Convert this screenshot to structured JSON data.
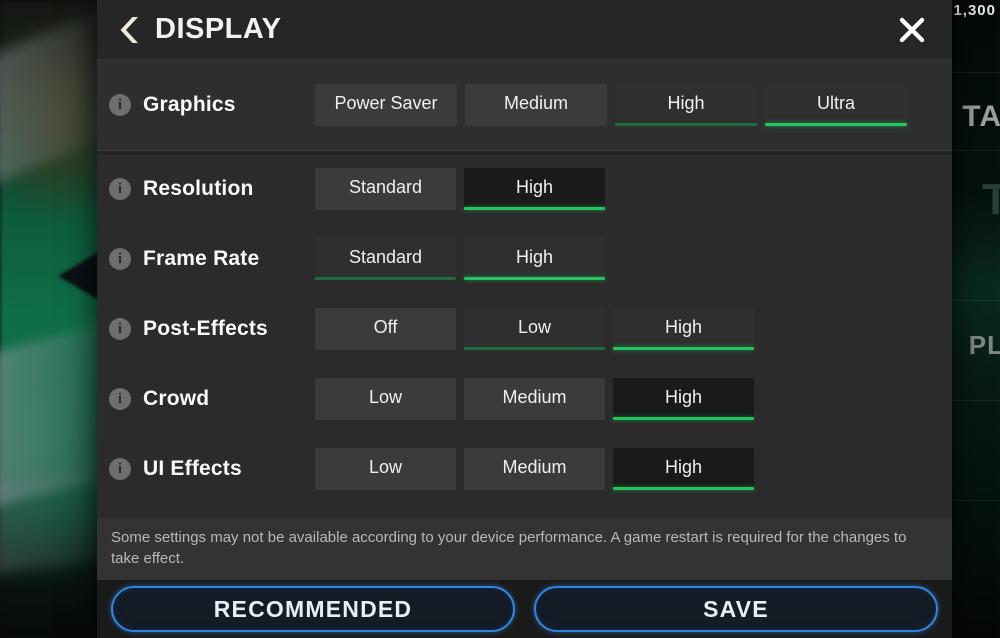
{
  "background": {
    "hud_score": "1,300",
    "hud_text_1": "TA",
    "hud_text_2": "T",
    "hud_text_3": "PL"
  },
  "header": {
    "title": "DISPLAY",
    "back_icon": "chevron-left-icon",
    "close_icon": "close-icon"
  },
  "settings": [
    {
      "label": "Graphics",
      "info_icon": "info-icon",
      "options": [
        {
          "label": "Power Saver",
          "state": "plain",
          "bar": "none"
        },
        {
          "label": "Medium",
          "state": "plain",
          "bar": "none"
        },
        {
          "label": "High",
          "state": "dim",
          "bar": "dim"
        },
        {
          "label": "Ultra",
          "state": "dim",
          "bar": "on"
        }
      ]
    },
    {
      "label": "Resolution",
      "info_icon": "info-icon",
      "options": [
        {
          "label": "Standard",
          "state": "plain",
          "bar": "none"
        },
        {
          "label": "High",
          "state": "dark",
          "bar": "on"
        }
      ]
    },
    {
      "label": "Frame Rate",
      "info_icon": "info-icon",
      "options": [
        {
          "label": "Standard",
          "state": "dim",
          "bar": "dim"
        },
        {
          "label": "High",
          "state": "dim",
          "bar": "on"
        }
      ]
    },
    {
      "label": "Post-Effects",
      "info_icon": "info-icon",
      "options": [
        {
          "label": "Off",
          "state": "plain",
          "bar": "none"
        },
        {
          "label": "Low",
          "state": "dim",
          "bar": "dim"
        },
        {
          "label": "High",
          "state": "dim",
          "bar": "on"
        }
      ]
    },
    {
      "label": "Crowd",
      "info_icon": "info-icon",
      "options": [
        {
          "label": "Low",
          "state": "plain",
          "bar": "none"
        },
        {
          "label": "Medium",
          "state": "plain",
          "bar": "none"
        },
        {
          "label": "High",
          "state": "dark",
          "bar": "on"
        }
      ]
    },
    {
      "label": "UI Effects",
      "info_icon": "info-icon",
      "options": [
        {
          "label": "Low",
          "state": "plain",
          "bar": "none"
        },
        {
          "label": "Medium",
          "state": "plain",
          "bar": "none"
        },
        {
          "label": "High",
          "state": "dark",
          "bar": "on"
        }
      ]
    }
  ],
  "note": "Some settings may not be available according to your device performance. A game restart is required for the changes to take effect.",
  "footer": {
    "recommended_label": "RECOMMENDED",
    "save_label": "SAVE"
  },
  "colors": {
    "accent_green": "#22c55e",
    "accent_green_dim": "#1d6b3f",
    "button_blue": "#2f86e0",
    "panel_bg": "#2b2b2b"
  }
}
